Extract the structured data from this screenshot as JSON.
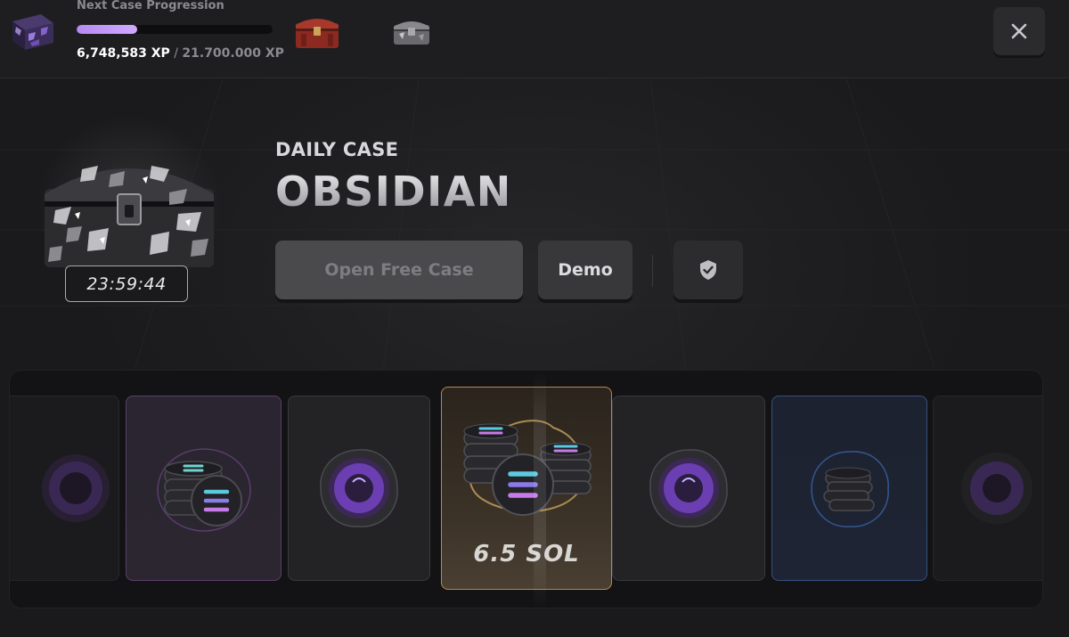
{
  "topbar": {
    "progress_label": "Next Case Progression",
    "progress_fraction": 0.31,
    "xp_current": "6,748,583 XP",
    "xp_separator": " / ",
    "xp_target": "21.700.000 XP",
    "close_icon": "close-icon"
  },
  "hero": {
    "timer": "23:59:44",
    "subtitle": "DAILY CASE",
    "title": "OBSIDIAN",
    "open_button": "Open Free Case",
    "demo_button": "Demo",
    "fair_icon": "shield-check-icon"
  },
  "reel": {
    "items": [
      {
        "kind": "purple-coin",
        "rarity": "purple"
      },
      {
        "kind": "sol-stack",
        "rarity": "purple"
      },
      {
        "kind": "purple-coin",
        "rarity": "common"
      },
      {
        "kind": "sol-pile",
        "rarity": "gold",
        "label": "6.5 SOL"
      },
      {
        "kind": "purple-coin",
        "rarity": "common"
      },
      {
        "kind": "coin-stack",
        "rarity": "blue"
      },
      {
        "kind": "purple-coin",
        "rarity": "common"
      }
    ]
  },
  "colors": {
    "accent_purple": "#c79cff",
    "gold_border": "#b58a4e",
    "blue_border": "#34527e",
    "background": "#1c1c1e"
  }
}
